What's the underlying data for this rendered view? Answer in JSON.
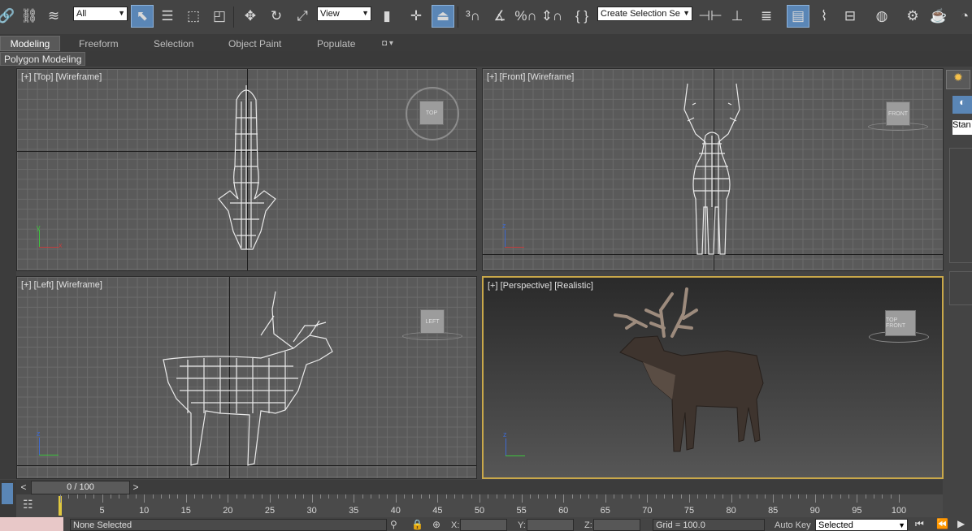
{
  "toolbar": {
    "selection_filter": "All",
    "ref_coord_system": "View",
    "named_selection_placeholder": "Create Selection Se"
  },
  "ribbon": {
    "tabs": [
      "Modeling",
      "Freeform",
      "Selection",
      "Object Paint",
      "Populate"
    ],
    "active_tab": "Modeling",
    "subpanel": "Polygon Modeling"
  },
  "viewports": {
    "top": "[+] [Top] [Wireframe]",
    "front": "[+] [Front] [Wireframe]",
    "left": "[+] [Left] [Wireframe]",
    "perspective": "[+] [Perspective] [Realistic]",
    "viewcube_top": "TOP",
    "viewcube_front": "FRONT",
    "viewcube_left": "LEFT",
    "viewcube_persp": "TOP FRONT"
  },
  "axes": {
    "x": "x",
    "y": "y",
    "z": "z"
  },
  "command_panel": {
    "type_field": "Stan"
  },
  "timeline": {
    "frame_readout": "0 / 100",
    "prev_label": "<",
    "next_label": ">",
    "ticks": [
      "5",
      "10",
      "15",
      "20",
      "25",
      "30",
      "35",
      "40",
      "45",
      "50",
      "55",
      "60",
      "65",
      "70",
      "75",
      "80",
      "85",
      "90",
      "95",
      "100"
    ]
  },
  "status": {
    "selection_text": "None Selected",
    "x_label": "X:",
    "y_label": "Y:",
    "z_label": "Z:",
    "grid_text": "Grid = 100.0",
    "auto_key_label": "Auto Key",
    "key_mode": "Selected"
  },
  "colors": {
    "accent": "#5a86b6",
    "active_viewport": "#c9a84a"
  }
}
